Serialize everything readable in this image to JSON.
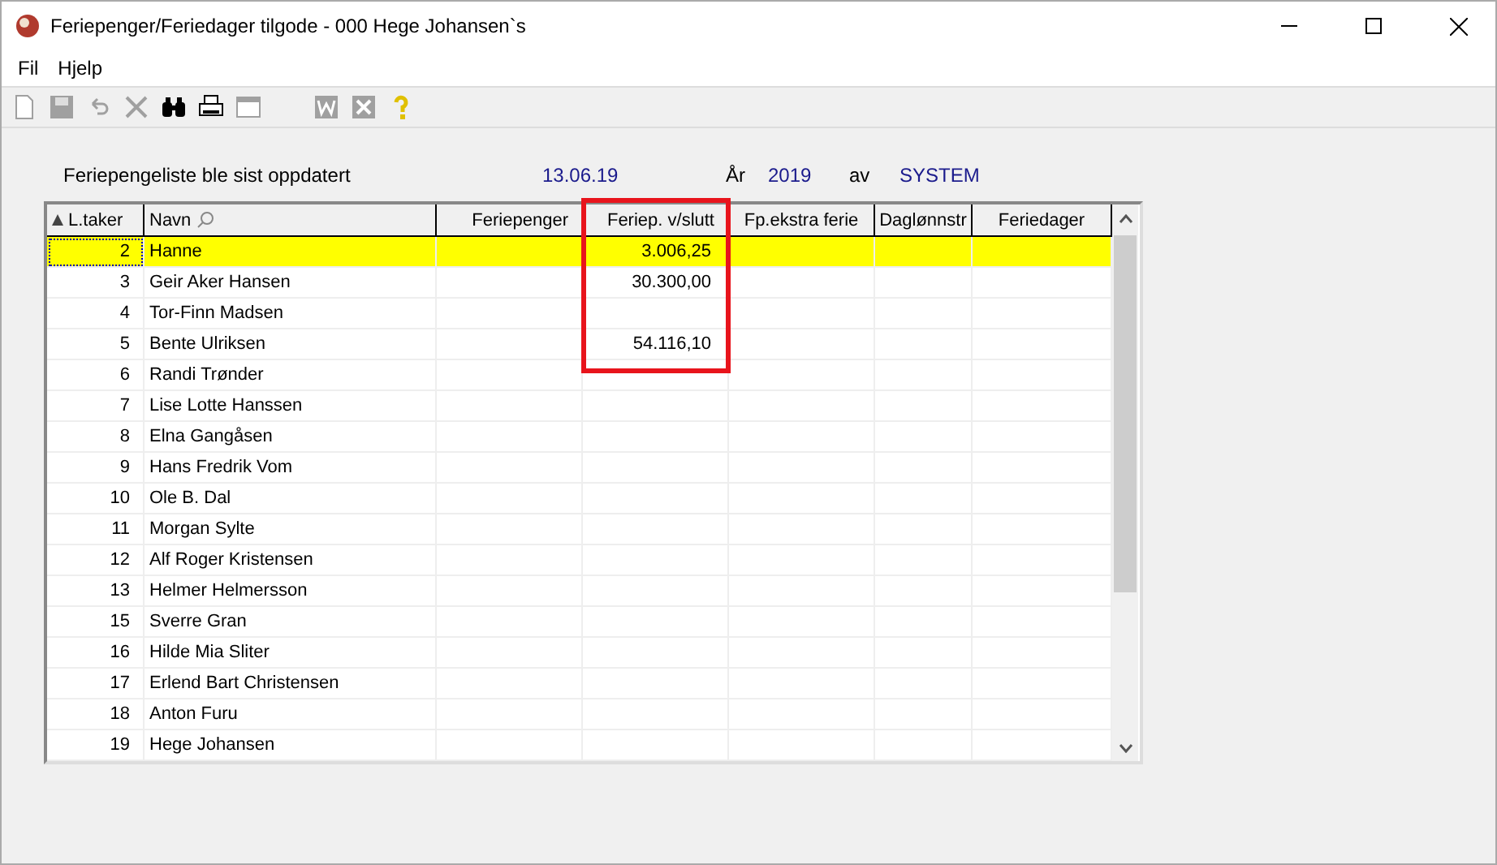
{
  "window": {
    "title": "Feriepenger/Feriedager tilgode - 000 Hege Johansen`s"
  },
  "menu": [
    "Fil",
    "Hjelp"
  ],
  "toolbar": [
    {
      "kind": "new",
      "disabled": true
    },
    {
      "kind": "save",
      "disabled": true
    },
    {
      "kind": "undo",
      "disabled": true
    },
    {
      "kind": "delete",
      "disabled": true
    },
    {
      "kind": "find",
      "disabled": false
    },
    {
      "kind": "print",
      "disabled": false
    },
    {
      "kind": "window",
      "disabled": true
    },
    {
      "kind": "word",
      "disabled": true
    },
    {
      "kind": "excel",
      "disabled": true
    },
    {
      "kind": "help",
      "disabled": false
    }
  ],
  "info": {
    "label": "Feriepengeliste ble sist oppdatert",
    "date": "13.06.19",
    "year_label": "År",
    "year": "2019",
    "by_label": "av",
    "by": "SYSTEM"
  },
  "table": {
    "columns": [
      "L.taker",
      "Navn",
      "Feriepenger",
      "Feriep. v/slutt",
      "Fp.ekstra ferie",
      "Daglønnstr",
      "Feriedager"
    ],
    "rows": [
      {
        "number": "2",
        "name": "Hanne",
        "feriep_v_slutt": "3.006,25",
        "selected": true
      },
      {
        "number": "3",
        "name": "Geir Aker Hansen",
        "feriep_v_slutt": "30.300,00",
        "selected": false
      },
      {
        "number": "4",
        "name": "Tor-Finn Madsen",
        "selected": false
      },
      {
        "number": "5",
        "name": "Bente Ulriksen",
        "feriep_v_slutt": "54.116,10",
        "selected": false
      },
      {
        "number": "6",
        "name": "Randi Trønder",
        "selected": false
      },
      {
        "number": "7",
        "name": "Lise Lotte Hanssen",
        "selected": false
      },
      {
        "number": "8",
        "name": "Elna Gangåsen",
        "selected": false
      },
      {
        "number": "9",
        "name": "Hans Fredrik Vom",
        "selected": false
      },
      {
        "number": "10",
        "name": "Ole B. Dal",
        "selected": false
      },
      {
        "number": "11",
        "name": "Morgan Sylte",
        "selected": false
      },
      {
        "number": "12",
        "name": "Alf Roger Kristensen",
        "selected": false
      },
      {
        "number": "13",
        "name": "Helmer Helmersson",
        "selected": false
      },
      {
        "number": "15",
        "name": "Sverre Gran",
        "selected": false
      },
      {
        "number": "16",
        "name": "Hilde Mia Sliter",
        "selected": false
      },
      {
        "number": "17",
        "name": "Erlend Bart Christensen",
        "selected": false
      },
      {
        "number": "18",
        "name": "Anton Furu",
        "selected": false
      },
      {
        "number": "19",
        "name": "Hege Johansen",
        "selected": false
      }
    ]
  }
}
